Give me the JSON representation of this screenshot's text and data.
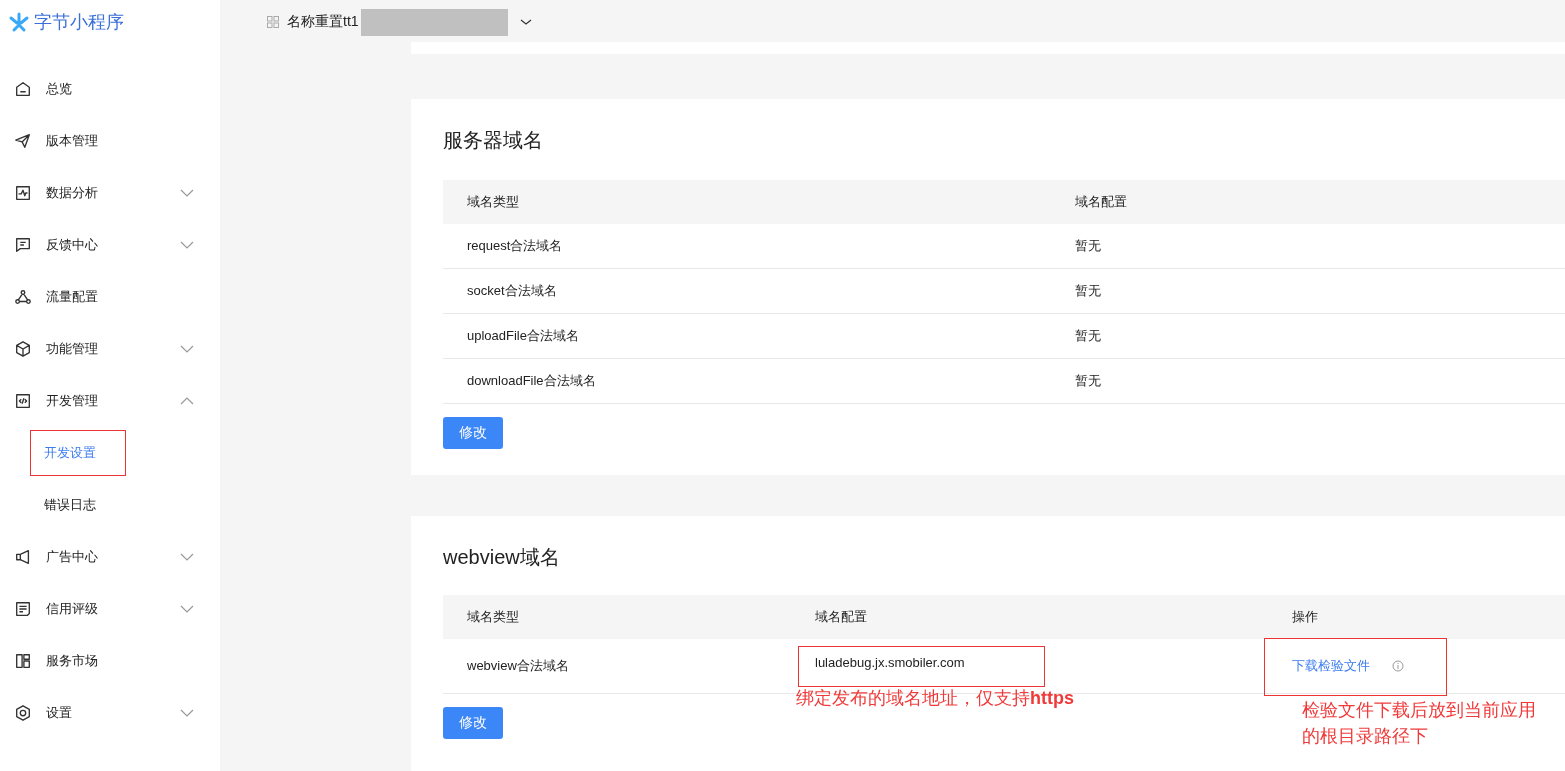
{
  "logo": {
    "text": "字节小程序"
  },
  "sidebar": {
    "items": [
      {
        "label": "总览"
      },
      {
        "label": "版本管理"
      },
      {
        "label": "数据分析",
        "expanded": false
      },
      {
        "label": "反馈中心",
        "expanded": false
      },
      {
        "label": "流量配置"
      },
      {
        "label": "功能管理",
        "expanded": false
      },
      {
        "label": "开发管理",
        "expanded": true,
        "children": [
          {
            "label": "开发设置",
            "selected": true,
            "boxed": true
          },
          {
            "label": "错误日志",
            "selected": false,
            "boxed": false
          }
        ]
      },
      {
        "label": "广告中心",
        "expanded": false
      },
      {
        "label": "信用评级",
        "expanded": false
      },
      {
        "label": "服务市场"
      },
      {
        "label": "设置",
        "expanded": false
      }
    ]
  },
  "header": {
    "app_name": "名称重置tt1"
  },
  "server_domains": {
    "title": "服务器域名",
    "columns": [
      "域名类型",
      "域名配置"
    ],
    "rows": [
      [
        "request合法域名",
        "暂无"
      ],
      [
        "socket合法域名",
        "暂无"
      ],
      [
        "uploadFile合法域名",
        "暂无"
      ],
      [
        "downloadFile合法域名",
        "暂无"
      ]
    ],
    "button": "修改"
  },
  "webview_domains": {
    "title": "webview域名",
    "columns": [
      "域名类型",
      "域名配置",
      "操作"
    ],
    "rows": [
      {
        "type": "webview合法域名",
        "config": "luladebug.jx.smobiler.com",
        "config_boxed": true,
        "action": "下载检验文件",
        "action_boxed": true,
        "config_note": "绑定发布的域名地址，仅支持**https**",
        "action_note": "检验文件下载后放到当前应用的根目录路径下"
      }
    ],
    "button": "修改"
  }
}
